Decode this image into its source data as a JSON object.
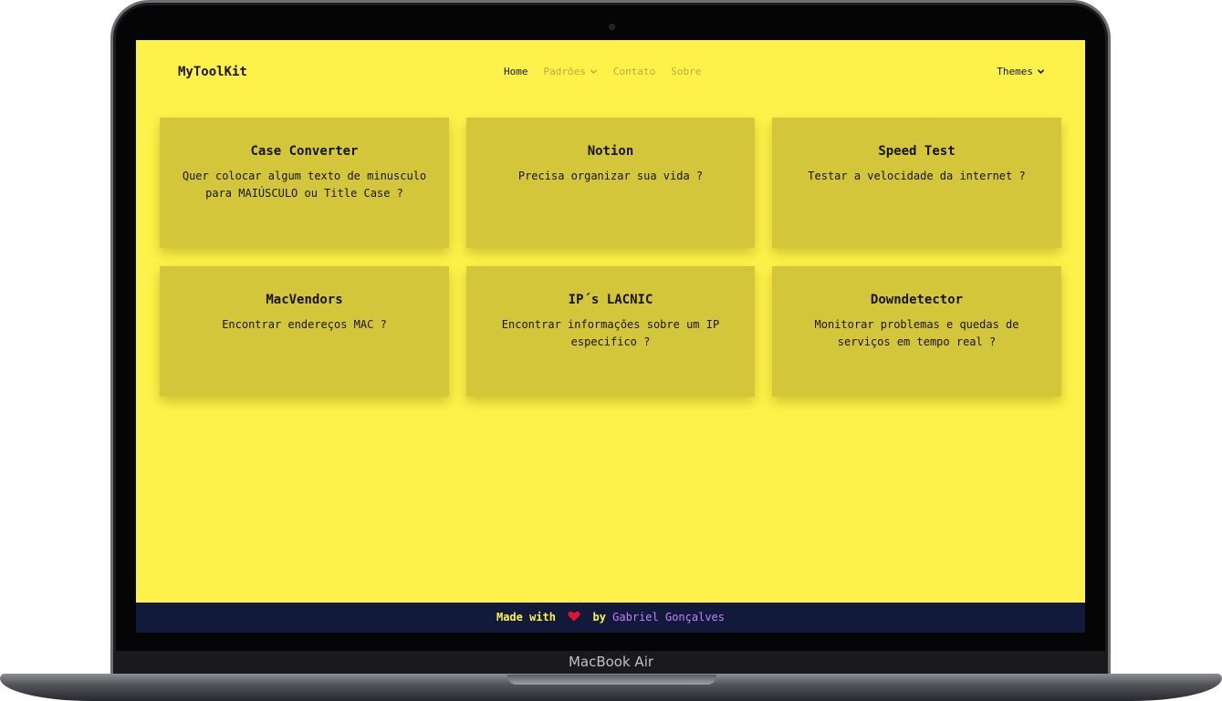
{
  "device": {
    "label": "MacBook Air"
  },
  "navbar": {
    "logo": "MyToolKit",
    "items": [
      {
        "label": "Home",
        "active": true,
        "has_dropdown": false
      },
      {
        "label": "Padrões",
        "active": false,
        "has_dropdown": true
      },
      {
        "label": "Contato",
        "active": false,
        "has_dropdown": false
      },
      {
        "label": "Sobre",
        "active": false,
        "has_dropdown": false
      }
    ],
    "themes_label": "Themes"
  },
  "cards": [
    {
      "title": "Case Converter",
      "description": "Quer colocar algum texto de minusculo para MAIÚSCULO ou Title Case ?"
    },
    {
      "title": "Notion",
      "description": "Precisa organizar sua vida ?"
    },
    {
      "title": "Speed Test",
      "description": "Testar a velocidade da internet ?"
    },
    {
      "title": "MacVendors",
      "description": "Encontrar endereços MAC ?"
    },
    {
      "title": "IP´s LACNIC",
      "description": "Encontrar informações sobre um IP especifico ?"
    },
    {
      "title": "Downdetector",
      "description": "Monitorar problemas e quedas de serviços em tempo real ?"
    }
  ],
  "footer": {
    "made_with": "Made with",
    "by": "by",
    "author": "Gabriel Gonçalves",
    "icon": "heart-icon"
  },
  "colors": {
    "background": "#fef24a",
    "card": "#d3c63b",
    "footer": "#111a3a",
    "author_link": "#c77dff"
  }
}
